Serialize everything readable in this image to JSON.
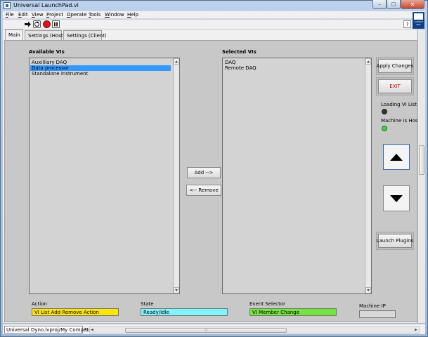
{
  "window": {
    "title": "Universal LaunchPad.vi",
    "close_glyph": "✕",
    "minimize_glyph": "–",
    "maximize_glyph": "□"
  },
  "menu": {
    "items": [
      {
        "label": "File",
        "accel": "F"
      },
      {
        "label": "Edit",
        "accel": "E"
      },
      {
        "label": "View",
        "accel": "V"
      },
      {
        "label": "Project",
        "accel": "P"
      },
      {
        "label": "Operate",
        "accel": "O"
      },
      {
        "label": "Tools",
        "accel": "T"
      },
      {
        "label": "Window",
        "accel": "W"
      },
      {
        "label": "Help",
        "accel": "H"
      }
    ]
  },
  "logo": {
    "text": "LAUNCH PAD",
    "brand_color": "#0f3d86"
  },
  "toolbar": {
    "help_glyph": "?"
  },
  "tabs": [
    {
      "label": "Main",
      "active": true
    },
    {
      "label": "Settings (Host)",
      "active": false
    },
    {
      "label": "Settings (Client)",
      "active": false
    }
  ],
  "available": {
    "label": "Available VIs",
    "items": [
      "Auxilliary DAQ",
      "Data processor",
      "Standalone Instrument"
    ],
    "selected_index": 1
  },
  "selected": {
    "label": "Selected VIs",
    "items": [
      "DAQ",
      "Remote DAQ"
    ]
  },
  "buttons": {
    "add": "Add -->",
    "remove": "<-- Remove",
    "apply": "Apply Changes",
    "exit": "EXIT",
    "launch": "Launch Plugins"
  },
  "indicators": {
    "loading_label": "Loading VI List",
    "loading_on": false,
    "host_label": "Machine is Host",
    "host_on": true,
    "colors": {
      "led_off": "#2a3a22",
      "led_on": "#39d43a",
      "exit_text": "#cc0000"
    }
  },
  "bottom": {
    "action": {
      "label": "Action",
      "value": "VI List Add Remove Action",
      "color": "#ffe600"
    },
    "state": {
      "label": "State",
      "value": "Ready/Idle",
      "color": "#7ff5ff"
    },
    "event": {
      "label": "Event Selector",
      "value": "VI Member Change",
      "color": "#73e63d"
    },
    "machine_ip": {
      "label": "Machine IP",
      "value": ""
    }
  },
  "statusbar": {
    "project_path": "Universal Dyno.lvproj/My Computer"
  }
}
